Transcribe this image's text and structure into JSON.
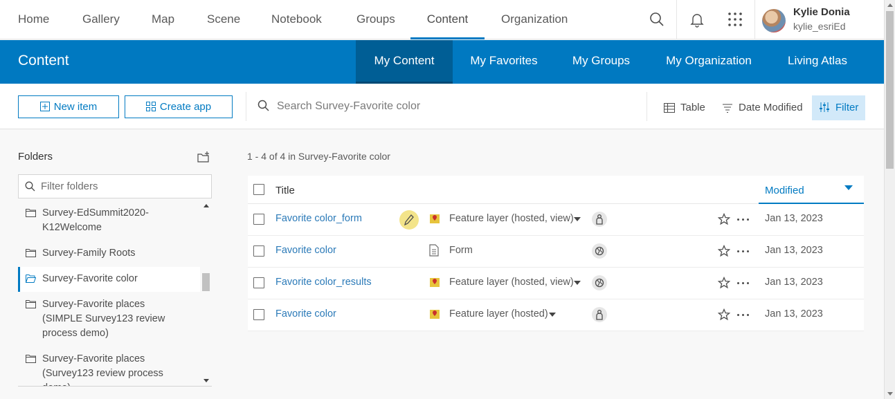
{
  "topnav": {
    "items": [
      "Home",
      "Gallery",
      "Map",
      "Scene",
      "Notebook",
      "Groups",
      "Content",
      "Organization"
    ],
    "active": "Content",
    "user": {
      "name": "Kylie Donia",
      "username": "kylie_esriEd"
    }
  },
  "banner": {
    "title": "Content",
    "tabs": [
      "My Content",
      "My Favorites",
      "My Groups",
      "My Organization",
      "Living Atlas"
    ],
    "active_tab": "My Content"
  },
  "toolbar": {
    "new_item": "New item",
    "create_app": "Create app",
    "search_placeholder": "Search Survey-Favorite color",
    "view": "Table",
    "sort": "Date Modified",
    "filter": "Filter"
  },
  "folders": {
    "title": "Folders",
    "filter_placeholder": "Filter folders",
    "items": [
      {
        "label": "Survey-EdSummit2020-K12Welcome"
      },
      {
        "label": "Survey-Family Roots"
      },
      {
        "label": "Survey-Favorite color",
        "selected": true
      },
      {
        "label": "Survey-Favorite places (SIMPLE Survey123 review process demo)"
      },
      {
        "label": "Survey-Favorite places (Survey123 review process demo)"
      }
    ]
  },
  "content": {
    "count_text": "1 - 4 of 4 in Survey-Favorite color",
    "columns": {
      "title": "Title",
      "modified": "Modified"
    },
    "rows": [
      {
        "title": "Favorite color_form",
        "type": "Feature layer (hosted, view)",
        "type_icon": "feature-layer-icon",
        "share_icon": "owner-only-icon",
        "modified": "Jan 13, 2023",
        "editing": true
      },
      {
        "title": "Favorite color",
        "type": "Form",
        "type_icon": "form-icon",
        "share_icon": "public-globe-icon",
        "modified": "Jan 13, 2023"
      },
      {
        "title": "Favorite color_results",
        "type": "Feature layer (hosted, view)",
        "type_icon": "feature-layer-icon",
        "share_icon": "public-globe-icon",
        "modified": "Jan 13, 2023"
      },
      {
        "title": "Favorite color",
        "type": "Feature layer (hosted)",
        "type_icon": "feature-layer-icon",
        "share_icon": "owner-only-icon",
        "modified": "Jan 13, 2023"
      }
    ]
  },
  "colors": {
    "brand_blue": "#0079c1",
    "accent": "#007ac2",
    "banner_active": "#005e95"
  }
}
